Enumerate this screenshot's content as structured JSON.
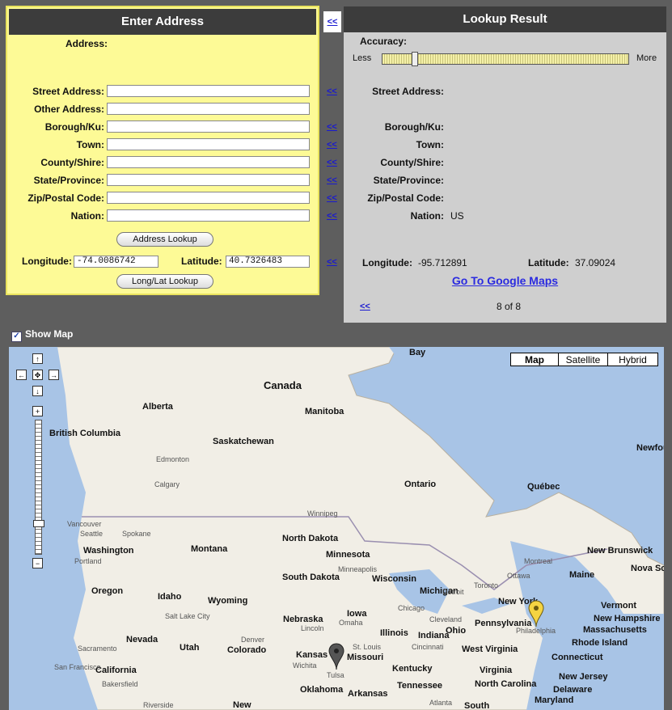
{
  "enter": {
    "title": "Enter Address",
    "address_label": "Address:",
    "fields": [
      {
        "label": "Street Address:",
        "value": "",
        "arrow": "<<"
      },
      {
        "label": "Other Address:",
        "value": "",
        "arrow": ""
      },
      {
        "label": "Borough/Ku:",
        "value": "",
        "arrow": "<<"
      },
      {
        "label": "Town:",
        "value": "",
        "arrow": "<<"
      },
      {
        "label": "County/Shire:",
        "value": "",
        "arrow": "<<"
      },
      {
        "label": "State/Province:",
        "value": "",
        "arrow": "<<"
      },
      {
        "label": "Zip/Postal Code:",
        "value": "",
        "arrow": "<<"
      },
      {
        "label": "Nation:",
        "value": "",
        "arrow": "<<"
      }
    ],
    "address_lookup": "Address Lookup",
    "longitude_label": "Longitude:",
    "longitude_value": "-74.0086742",
    "latitude_label": "Latitude:",
    "latitude_value": "40.7326483",
    "coords_arrow": "<<",
    "longlat_lookup": "Long/Lat Lookup",
    "top_arrow": "<<"
  },
  "result": {
    "title": "Lookup Result",
    "accuracy_label": "Accuracy:",
    "less": "Less",
    "more": "More",
    "accuracy_level": 0.12,
    "fields": [
      {
        "label": "Street Address:",
        "value": ""
      },
      {
        "label": "Borough/Ku:",
        "value": ""
      },
      {
        "label": "Town:",
        "value": ""
      },
      {
        "label": "County/Shire:",
        "value": ""
      },
      {
        "label": "State/Province:",
        "value": ""
      },
      {
        "label": "Zip/Postal Code:",
        "value": ""
      },
      {
        "label": "Nation:",
        "value": "US"
      }
    ],
    "longitude_label": "Longitude:",
    "longitude_value": "-95.712891",
    "latitude_label": "Latitude:",
    "latitude_value": "37.09024",
    "goto_link": "Go To Google Maps",
    "back_arrow": "<<",
    "page_count": "8 of 8"
  },
  "show_map": {
    "label": "Show Map",
    "checked": true
  },
  "map": {
    "types": [
      "Map",
      "Satellite",
      "Hybrid"
    ],
    "selected_type": "Map",
    "nav": {
      "up": "↑",
      "left": "←",
      "center": "✥",
      "right": "→",
      "down": "↓",
      "zoom_in": "+",
      "zoom_out": "−"
    },
    "zoom_level": 0.77,
    "labels": [
      "Bay",
      "Canada",
      "Alberta",
      "Manitoba",
      "British Columbia",
      "Saskatchewan",
      "Ontario",
      "Québec",
      "Newfoundland and Labrador",
      "North Dakota",
      "Minnesota",
      "Washington",
      "Montana",
      "South Dakota",
      "Wisconsin",
      "Michigan",
      "New Brunswick",
      "Nova Scotia",
      "Maine",
      "Oregon",
      "Idaho",
      "Wyoming",
      "Iowa",
      "Nebraska",
      "Illinois",
      "Indiana",
      "Ohio",
      "Pennsylvania",
      "New York",
      "Vermont",
      "New Hampshire",
      "Massachusetts",
      "Rhode Island",
      "Connecticut",
      "New Jersey",
      "Delaware",
      "Maryland",
      "Nevada",
      "Utah",
      "Colorado",
      "Kansas",
      "Missouri",
      "Kentucky",
      "West Virginia",
      "Virginia",
      "California",
      "Oklahoma",
      "Arkansas",
      "Tennessee",
      "North Carolina",
      "South",
      "New"
    ],
    "cities": [
      "Edmonton",
      "Calgary",
      "Winnipeg",
      "Vancouver",
      "Seattle",
      "Spokane",
      "Portland",
      "Minneapolis",
      "Chicago",
      "Detroit",
      "Toronto",
      "Ottawa",
      "Montreal",
      "Cleveland",
      "Salt Lake City",
      "Omaha",
      "Lincoln",
      "Denver",
      "St. Louis",
      "Cincinnati",
      "Wichita",
      "Tulsa",
      "Sacramento",
      "San Francisco",
      "Bakersfield",
      "Riverside",
      "Atlanta",
      "Philadelphia",
      "Detroit"
    ]
  }
}
